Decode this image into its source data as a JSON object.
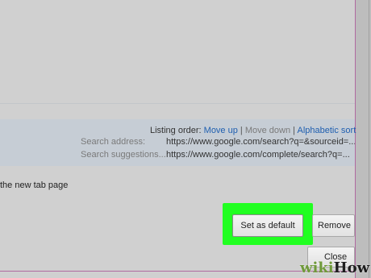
{
  "listing": {
    "label": "Listing order:",
    "move_up": "Move up",
    "separator": "|",
    "move_down": "Move down",
    "alphabetic_sort": "Alphabetic sort"
  },
  "search_address": {
    "label": "Search address:",
    "value": "https://www.google.com/search?q=&sourceid=..."
  },
  "search_suggestions": {
    "label": "Search suggestions...",
    "value": "https://www.google.com/complete/search?q=..."
  },
  "new_tab_text": "the new tab page",
  "buttons": {
    "set_as_default": "Set as default",
    "remove": "Remove",
    "close": "Close"
  },
  "watermark": {
    "wiki": "wiki",
    "how": "How"
  },
  "colors": {
    "highlight": "#21ff21",
    "link": "#1f5fb0",
    "accent_border": "#b06aa0"
  }
}
